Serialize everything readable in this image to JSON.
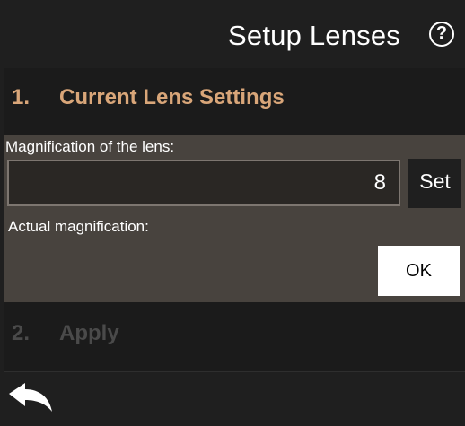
{
  "header": {
    "title": "Setup Lenses",
    "help_symbol": "?"
  },
  "steps": [
    {
      "number": "1.",
      "label": "Current Lens Settings",
      "active": true
    },
    {
      "number": "2.",
      "label": "Apply",
      "active": false
    }
  ],
  "lens_settings": {
    "magnification_label": "Magnification of the lens:",
    "magnification_value": "8",
    "set_label": "Set",
    "actual_magnification_label": "Actual magnification:",
    "ok_label": "OK"
  },
  "footer": {
    "back_icon": "back-arrow-icon"
  },
  "colors": {
    "active_step": "#d9a679",
    "inactive_step": "#4a4a4a",
    "panel_background": "#48433e",
    "window_background": "#1f1f1f"
  }
}
